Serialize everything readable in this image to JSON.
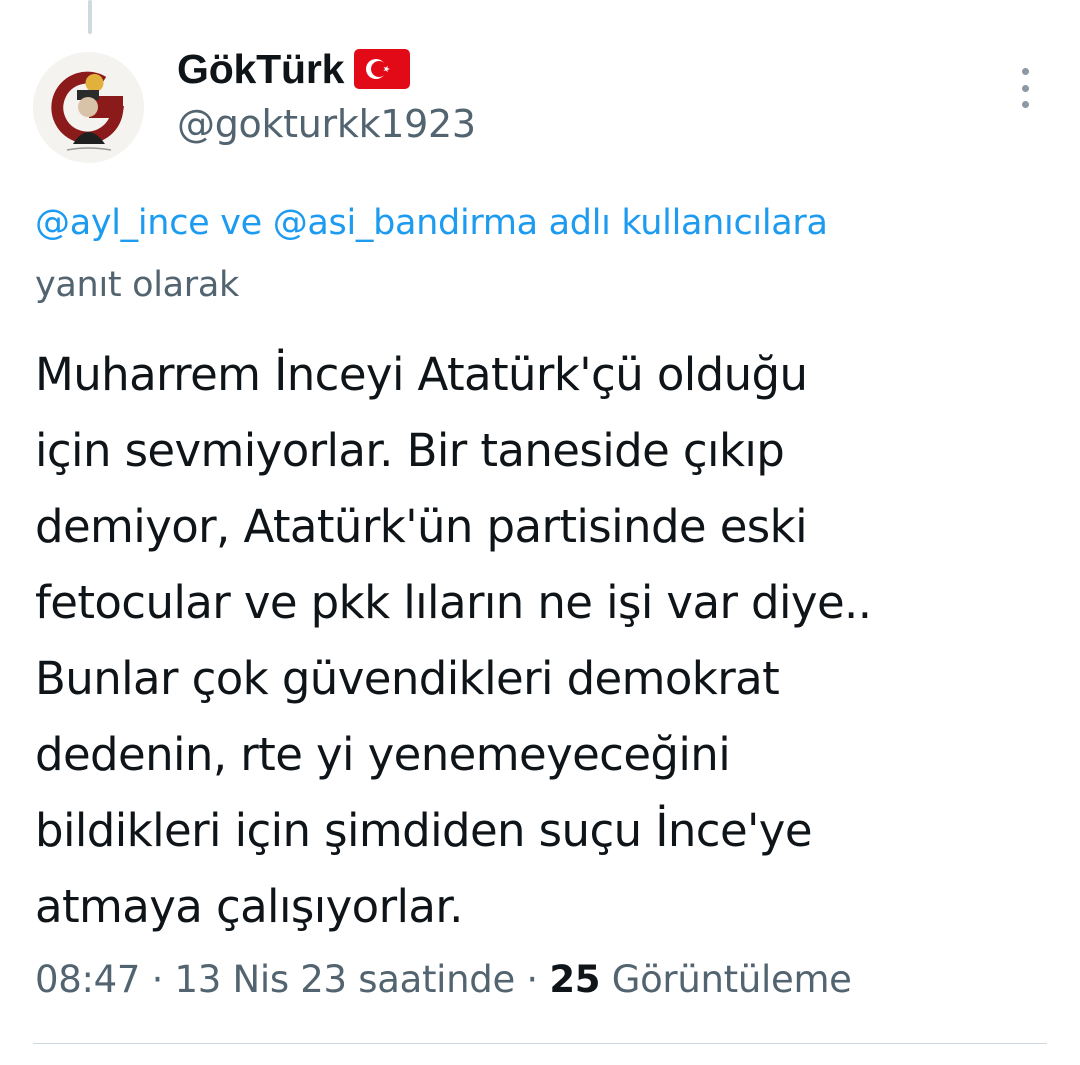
{
  "author": {
    "display_name": "GökTürk",
    "flag_icon": "turkey-flag-icon",
    "handle": "@gokturkk1923"
  },
  "reply_context": {
    "mention_1": "@ayl_ince",
    "connector": "ve",
    "mention_2": "@asi_bandirma",
    "suffix_1": "adlı kullanıcılara",
    "suffix_2": "yanıt olarak"
  },
  "tweet": {
    "lines": [
      "Muharrem İnceyi Atatürk'çü olduğu",
      "için sevmiyorlar. Bir taneside çıkıp",
      "demiyor, Atatürk'ün partisinde eski",
      "fetocular ve pkk lıların ne işi var diye..",
      "Bunlar çok güvendikleri demokrat",
      "dedenin, rte yi yenemeyeceğini",
      "bildikleri için şimdiden suçu İnce'ye",
      "atmaya çalışıyorlar."
    ]
  },
  "meta": {
    "time": "08:47",
    "separator": "·",
    "date": "13 Nis 23 saatinde",
    "views_count": "25",
    "views_label": "Görüntüleme"
  },
  "colors": {
    "link": "#1d9bf0",
    "secondary_text": "#536471",
    "primary_text": "#0f1419",
    "divider": "#cfd9de"
  },
  "icons": {
    "more": "more-vertical-icon",
    "avatar": "avatar"
  }
}
